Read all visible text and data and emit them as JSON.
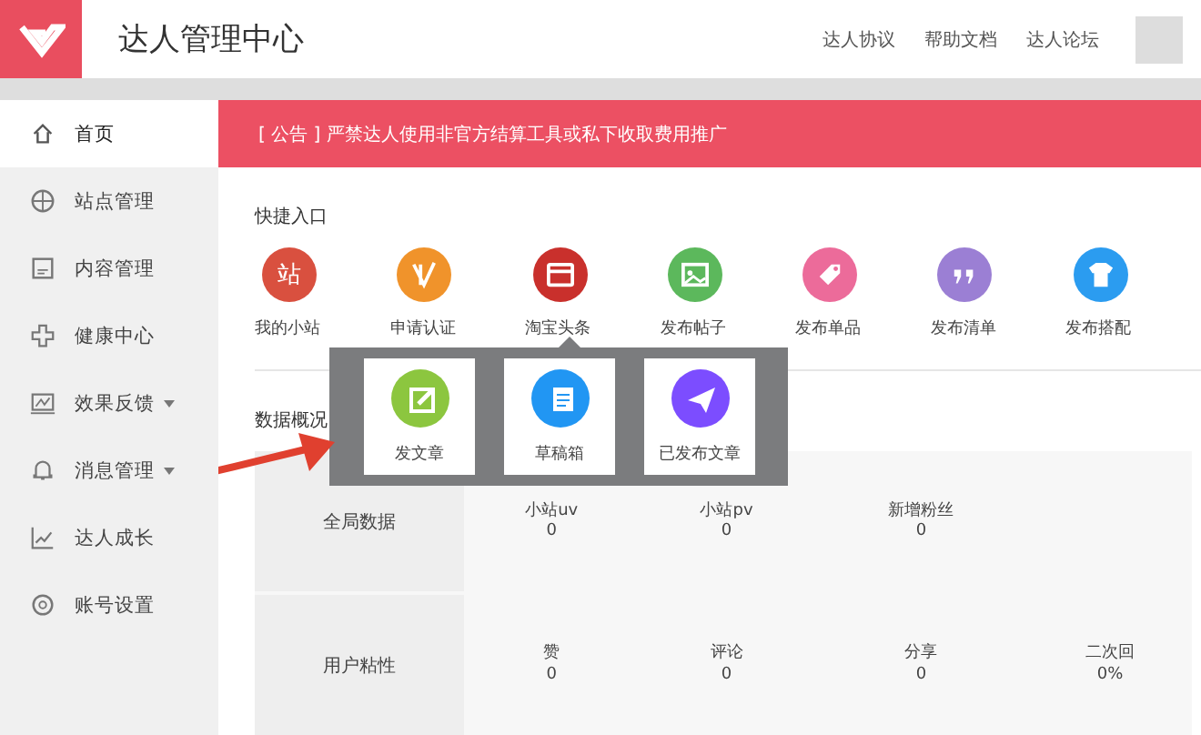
{
  "header": {
    "title": "达人管理中心",
    "links": [
      "达人协议",
      "帮助文档",
      "达人论坛"
    ]
  },
  "sidebar": {
    "items": [
      {
        "label": "首页",
        "selected": true,
        "expandable": false
      },
      {
        "label": "站点管理",
        "selected": false,
        "expandable": false
      },
      {
        "label": "内容管理",
        "selected": false,
        "expandable": false
      },
      {
        "label": "健康中心",
        "selected": false,
        "expandable": false
      },
      {
        "label": "效果反馈",
        "selected": false,
        "expandable": true
      },
      {
        "label": "消息管理",
        "selected": false,
        "expandable": true
      },
      {
        "label": "达人成长",
        "selected": false,
        "expandable": false
      },
      {
        "label": "账号设置",
        "selected": false,
        "expandable": false
      }
    ]
  },
  "notice": "[ 公告 ] 严禁达人使用非官方结算工具或私下收取费用推广",
  "quick_entry": {
    "title": "快捷入口",
    "items": [
      {
        "label": "我的小站",
        "color": "#d9503f",
        "glyph": "站"
      },
      {
        "label": "申请认证",
        "color": "#f0932b"
      },
      {
        "label": "淘宝头条",
        "color": "#c9302c"
      },
      {
        "label": "发布帖子",
        "color": "#5cb85c"
      },
      {
        "label": "发布单品",
        "color": "#ec6b9a"
      },
      {
        "label": "发布清单",
        "color": "#9b7fd4"
      },
      {
        "label": "发布搭配",
        "color": "#2b9cf0"
      }
    ]
  },
  "popover": {
    "items": [
      {
        "label": "发文章",
        "color": "#8cc63f"
      },
      {
        "label": "草稿箱",
        "color": "#2196f3"
      },
      {
        "label": "已发布文章",
        "color": "#7c4dff"
      }
    ]
  },
  "data_overview": {
    "title": "数据概况",
    "rows": [
      {
        "label": "全局数据",
        "cells": [
          {
            "name": "小站uv",
            "value": "0"
          },
          {
            "name": "小站pv",
            "value": "0"
          },
          {
            "name": "新增粉丝",
            "value": "0"
          }
        ]
      },
      {
        "label": "用户粘性",
        "cells": [
          {
            "name": "赞",
            "value": "0"
          },
          {
            "name": "评论",
            "value": "0"
          },
          {
            "name": "分享",
            "value": "0"
          },
          {
            "name": "二次回",
            "value": "0%"
          }
        ]
      }
    ]
  }
}
